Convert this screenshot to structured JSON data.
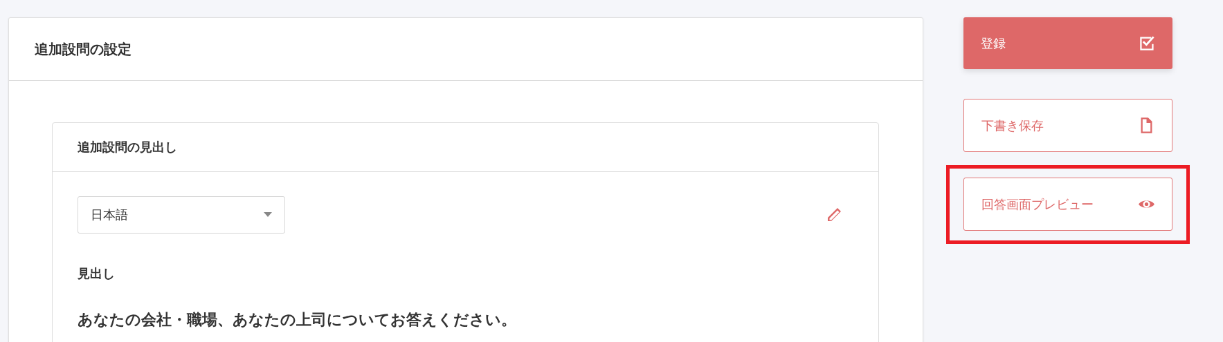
{
  "settings_card": {
    "title": "追加設問の設定",
    "heading_card": {
      "title": "追加設問の見出し",
      "language_select": {
        "value": "日本語"
      },
      "field_label": "見出し",
      "heading_text": "あなたの会社・職場、あなたの上司についてお答えください。"
    }
  },
  "actions": [
    {
      "label": "登録",
      "kind": "primary",
      "highlighted": false
    },
    {
      "label": "下書き保存",
      "kind": "outline",
      "highlighted": false
    },
    {
      "label": "回答画面プレビュー",
      "kind": "outline",
      "highlighted": true
    }
  ]
}
